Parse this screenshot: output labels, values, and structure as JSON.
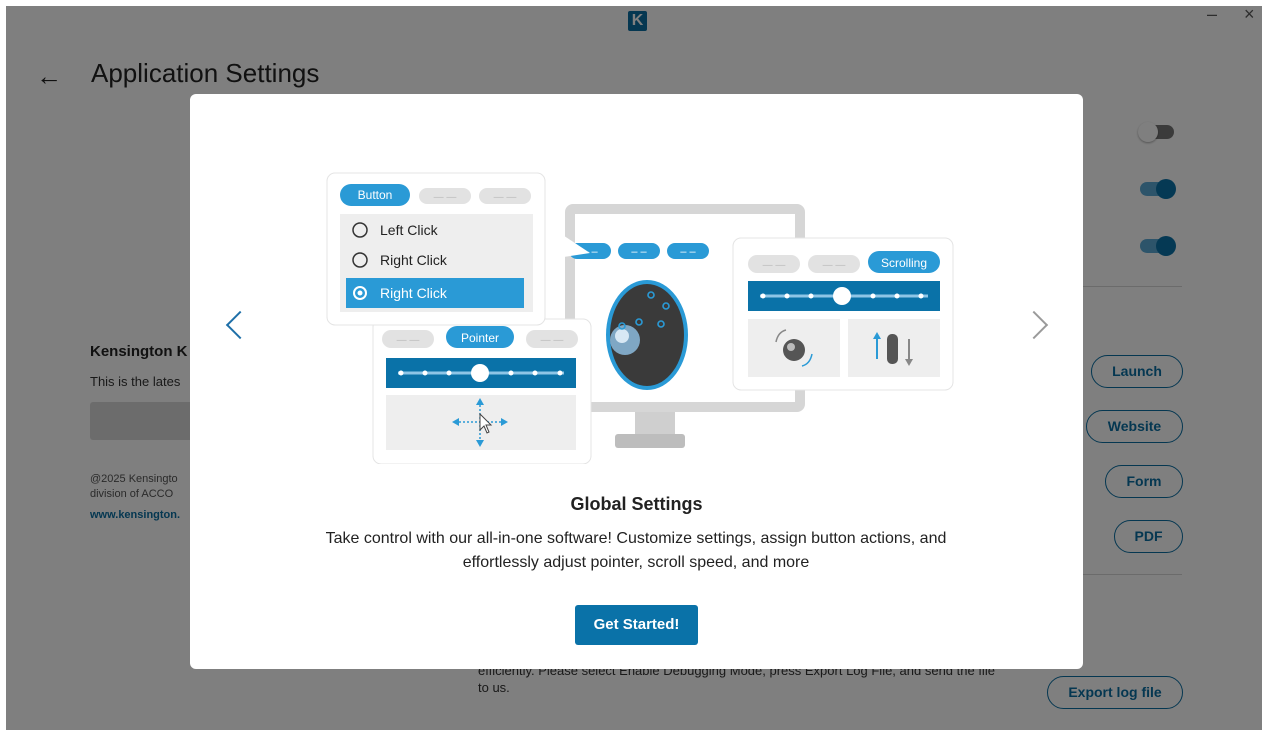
{
  "window": {
    "logo_letter": "K",
    "minimize_label": "–",
    "close_label": "×"
  },
  "header": {
    "back_icon": "←",
    "title": "Application Settings"
  },
  "toggles": [
    {
      "state": "off"
    },
    {
      "state": "on"
    },
    {
      "state": "on"
    }
  ],
  "side_buttons": {
    "launch": "Launch",
    "website": "Website",
    "form": "Form",
    "pdf": "PDF",
    "export_log": "Export log file"
  },
  "background": {
    "section_title": "Kensington K",
    "section_text": "This is the lates",
    "copyright_line1": "@2025 Kensingto",
    "copyright_line2": "division of ACCO",
    "website_link": "www.kensington.",
    "debug_line1": "efficiently. Please select Enable Debugging Mode, press Export Log File, and send the file",
    "debug_line2": "to us."
  },
  "modal": {
    "prev_icon": "chevron-left-icon",
    "next_icon": "chevron-right-icon",
    "title": "Global Settings",
    "description": "Take control with our all-in-one software! Customize settings, assign button actions, and effortlessly adjust pointer, scroll speed, and more",
    "cta": "Get Started!",
    "illustration": {
      "button_tab": "Button",
      "pointer_tab": "Pointer",
      "scrolling_tab": "Scrolling",
      "dash_tab": "— —",
      "monitor_tab": "– –",
      "options": [
        "Left Click",
        "Right Click",
        "Right Click"
      ],
      "selected_option": 2
    }
  },
  "colors": {
    "accent": "#0a72a8",
    "accent_light": "#2a9ad6",
    "overlay": "rgba(0,0,0,0.5)"
  }
}
